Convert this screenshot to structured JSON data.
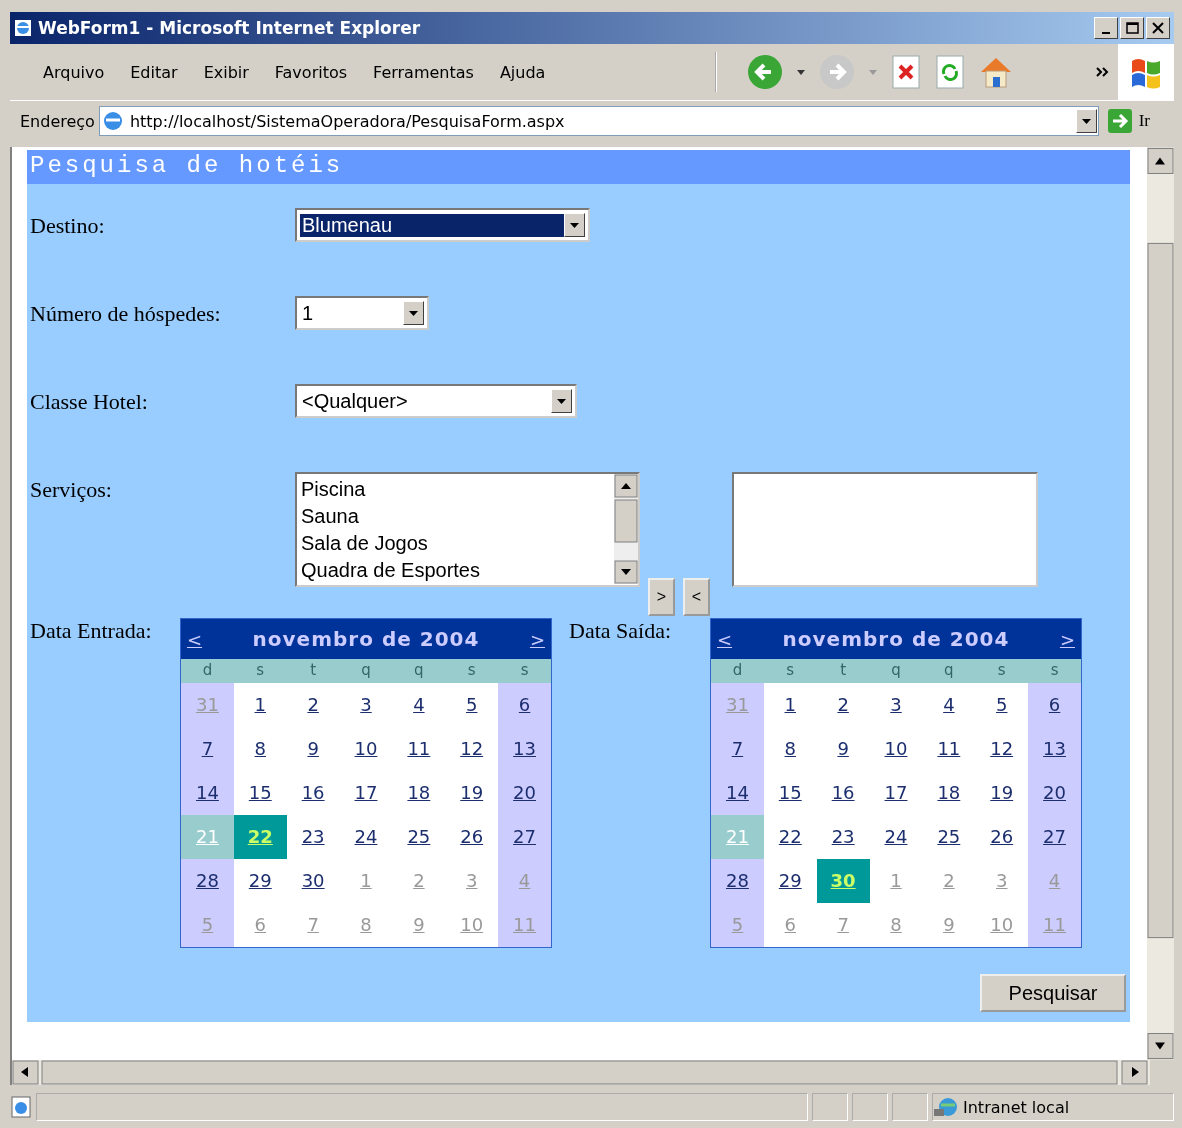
{
  "window": {
    "title": "WebForm1 - Microsoft Internet Explorer"
  },
  "menu": [
    "Arquivo",
    "Editar",
    "Exibir",
    "Favoritos",
    "Ferramentas",
    "Ajuda"
  ],
  "address_bar": {
    "label": "Endereço",
    "url": "http://localhost/SistemaOperadora/PesquisaForm.aspx",
    "go_label": "Ir"
  },
  "page": {
    "heading": "Pesquisa de hotéis",
    "fields": [
      {
        "kind": "select",
        "label": "Destino:",
        "value": "Blumenau",
        "focused": true
      },
      {
        "kind": "select",
        "label": "Número de hóspedes:",
        "value": "1",
        "focused": false
      },
      {
        "kind": "select",
        "label": "Classe Hotel:",
        "value": "<Qualquer>",
        "focused": false
      },
      {
        "kind": "listbox",
        "label": "Serviços:",
        "options": [
          "Piscina",
          "Sauna",
          "Sala de Jogos",
          "Quadra de Esportes"
        ],
        "add_button": ">",
        "remove_button": "<"
      }
    ],
    "calendars": [
      {
        "label": "Data Entrada:",
        "title": "novembro de 2004",
        "prev": "<",
        "next": ">",
        "weekdays": [
          "d",
          "s",
          "t",
          "q",
          "q",
          "s",
          "s"
        ],
        "days": [
          {
            "text": "31",
            "other_month": true,
            "today": false,
            "selected": false
          },
          {
            "text": "1",
            "other_month": false,
            "today": false,
            "selected": false
          },
          {
            "text": "2",
            "other_month": false,
            "today": false,
            "selected": false
          },
          {
            "text": "3",
            "other_month": false,
            "today": false,
            "selected": false
          },
          {
            "text": "4",
            "other_month": false,
            "today": false,
            "selected": false
          },
          {
            "text": "5",
            "other_month": false,
            "today": false,
            "selected": false
          },
          {
            "text": "6",
            "other_month": false,
            "today": false,
            "selected": false
          },
          {
            "text": "7",
            "other_month": false,
            "today": false,
            "selected": false
          },
          {
            "text": "8",
            "other_month": false,
            "today": false,
            "selected": false
          },
          {
            "text": "9",
            "other_month": false,
            "today": false,
            "selected": false
          },
          {
            "text": "10",
            "other_month": false,
            "today": false,
            "selected": false
          },
          {
            "text": "11",
            "other_month": false,
            "today": false,
            "selected": false
          },
          {
            "text": "12",
            "other_month": false,
            "today": false,
            "selected": false
          },
          {
            "text": "13",
            "other_month": false,
            "today": false,
            "selected": false
          },
          {
            "text": "14",
            "other_month": false,
            "today": false,
            "selected": false
          },
          {
            "text": "15",
            "other_month": false,
            "today": false,
            "selected": false
          },
          {
            "text": "16",
            "other_month": false,
            "today": false,
            "selected": false
          },
          {
            "text": "17",
            "other_month": false,
            "today": false,
            "selected": false
          },
          {
            "text": "18",
            "other_month": false,
            "today": false,
            "selected": false
          },
          {
            "text": "19",
            "other_month": false,
            "today": false,
            "selected": false
          },
          {
            "text": "20",
            "other_month": false,
            "today": false,
            "selected": false
          },
          {
            "text": "21",
            "other_month": false,
            "today": true,
            "selected": false
          },
          {
            "text": "22",
            "other_month": false,
            "today": false,
            "selected": true
          },
          {
            "text": "23",
            "other_month": false,
            "today": false,
            "selected": false
          },
          {
            "text": "24",
            "other_month": false,
            "today": false,
            "selected": false
          },
          {
            "text": "25",
            "other_month": false,
            "today": false,
            "selected": false
          },
          {
            "text": "26",
            "other_month": false,
            "today": false,
            "selected": false
          },
          {
            "text": "27",
            "other_month": false,
            "today": false,
            "selected": false
          },
          {
            "text": "28",
            "other_month": false,
            "today": false,
            "selected": false
          },
          {
            "text": "29",
            "other_month": false,
            "today": false,
            "selected": false
          },
          {
            "text": "30",
            "other_month": false,
            "today": false,
            "selected": false
          },
          {
            "text": "1",
            "other_month": true,
            "today": false,
            "selected": false
          },
          {
            "text": "2",
            "other_month": true,
            "today": false,
            "selected": false
          },
          {
            "text": "3",
            "other_month": true,
            "today": false,
            "selected": false
          },
          {
            "text": "4",
            "other_month": true,
            "today": false,
            "selected": false
          },
          {
            "text": "5",
            "other_month": true,
            "today": false,
            "selected": false
          },
          {
            "text": "6",
            "other_month": true,
            "today": false,
            "selected": false
          },
          {
            "text": "7",
            "other_month": true,
            "today": false,
            "selected": false
          },
          {
            "text": "8",
            "other_month": true,
            "today": false,
            "selected": false
          },
          {
            "text": "9",
            "other_month": true,
            "today": false,
            "selected": false
          },
          {
            "text": "10",
            "other_month": true,
            "today": false,
            "selected": false
          },
          {
            "text": "11",
            "other_month": true,
            "today": false,
            "selected": false
          }
        ]
      },
      {
        "label": "Data Saída:",
        "title": "novembro de 2004",
        "prev": "<",
        "next": ">",
        "weekdays": [
          "d",
          "s",
          "t",
          "q",
          "q",
          "s",
          "s"
        ],
        "days": [
          {
            "text": "31",
            "other_month": true,
            "today": false,
            "selected": false
          },
          {
            "text": "1",
            "other_month": false,
            "today": false,
            "selected": false
          },
          {
            "text": "2",
            "other_month": false,
            "today": false,
            "selected": false
          },
          {
            "text": "3",
            "other_month": false,
            "today": false,
            "selected": false
          },
          {
            "text": "4",
            "other_month": false,
            "today": false,
            "selected": false
          },
          {
            "text": "5",
            "other_month": false,
            "today": false,
            "selected": false
          },
          {
            "text": "6",
            "other_month": false,
            "today": false,
            "selected": false
          },
          {
            "text": "7",
            "other_month": false,
            "today": false,
            "selected": false
          },
          {
            "text": "8",
            "other_month": false,
            "today": false,
            "selected": false
          },
          {
            "text": "9",
            "other_month": false,
            "today": false,
            "selected": false
          },
          {
            "text": "10",
            "other_month": false,
            "today": false,
            "selected": false
          },
          {
            "text": "11",
            "other_month": false,
            "today": false,
            "selected": false
          },
          {
            "text": "12",
            "other_month": false,
            "today": false,
            "selected": false
          },
          {
            "text": "13",
            "other_month": false,
            "today": false,
            "selected": false
          },
          {
            "text": "14",
            "other_month": false,
            "today": false,
            "selected": false
          },
          {
            "text": "15",
            "other_month": false,
            "today": false,
            "selected": false
          },
          {
            "text": "16",
            "other_month": false,
            "today": false,
            "selected": false
          },
          {
            "text": "17",
            "other_month": false,
            "today": false,
            "selected": false
          },
          {
            "text": "18",
            "other_month": false,
            "today": false,
            "selected": false
          },
          {
            "text": "19",
            "other_month": false,
            "today": false,
            "selected": false
          },
          {
            "text": "20",
            "other_month": false,
            "today": false,
            "selected": false
          },
          {
            "text": "21",
            "other_month": false,
            "today": true,
            "selected": false
          },
          {
            "text": "22",
            "other_month": false,
            "today": false,
            "selected": false
          },
          {
            "text": "23",
            "other_month": false,
            "today": false,
            "selected": false
          },
          {
            "text": "24",
            "other_month": false,
            "today": false,
            "selected": false
          },
          {
            "text": "25",
            "other_month": false,
            "today": false,
            "selected": false
          },
          {
            "text": "26",
            "other_month": false,
            "today": false,
            "selected": false
          },
          {
            "text": "27",
            "other_month": false,
            "today": false,
            "selected": false
          },
          {
            "text": "28",
            "other_month": false,
            "today": false,
            "selected": false
          },
          {
            "text": "29",
            "other_month": false,
            "today": false,
            "selected": false
          },
          {
            "text": "30",
            "other_month": false,
            "today": false,
            "selected": true
          },
          {
            "text": "1",
            "other_month": true,
            "today": false,
            "selected": false
          },
          {
            "text": "2",
            "other_month": true,
            "today": false,
            "selected": false
          },
          {
            "text": "3",
            "other_month": true,
            "today": false,
            "selected": false
          },
          {
            "text": "4",
            "other_month": true,
            "today": false,
            "selected": false
          },
          {
            "text": "5",
            "other_month": true,
            "today": false,
            "selected": false
          },
          {
            "text": "6",
            "other_month": true,
            "today": false,
            "selected": false
          },
          {
            "text": "7",
            "other_month": true,
            "today": false,
            "selected": false
          },
          {
            "text": "8",
            "other_month": true,
            "today": false,
            "selected": false
          },
          {
            "text": "9",
            "other_month": true,
            "today": false,
            "selected": false
          },
          {
            "text": "10",
            "other_month": true,
            "today": false,
            "selected": false
          },
          {
            "text": "11",
            "other_month": true,
            "today": false,
            "selected": false
          }
        ]
      }
    ],
    "submit_button": "Pesquisar"
  },
  "status_bar": {
    "zone": "Intranet local"
  }
}
